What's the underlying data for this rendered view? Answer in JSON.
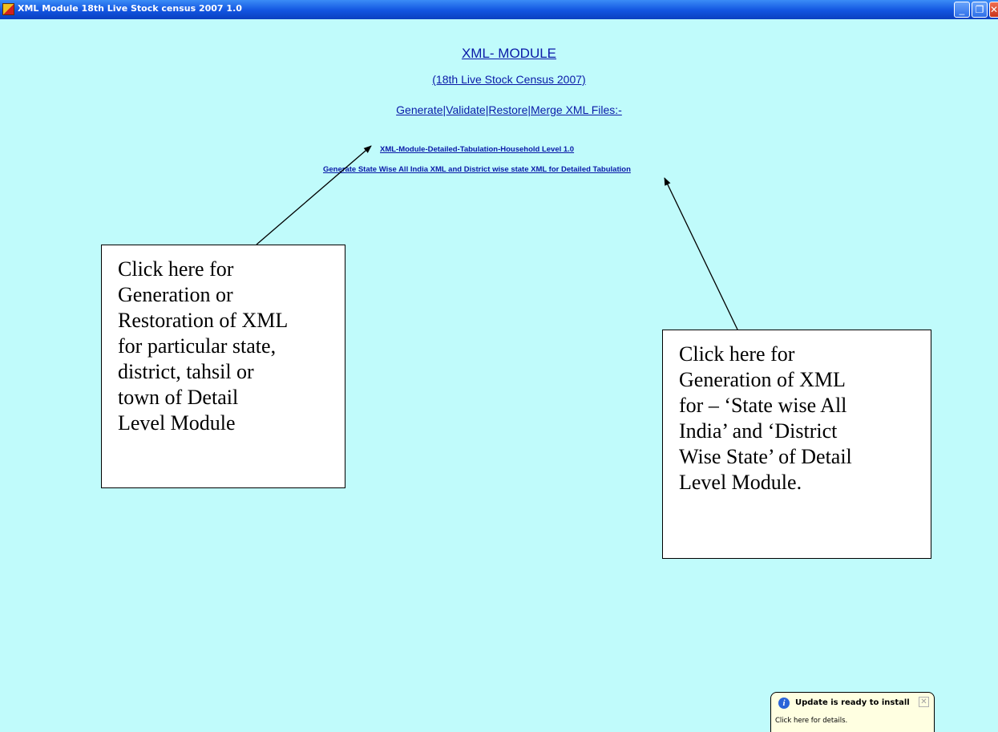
{
  "window": {
    "title": "XML Module 18th Live Stock census 2007 1.0",
    "controls": {
      "minimize": "_",
      "restore": "❐",
      "close": "✕"
    }
  },
  "main": {
    "heading": "XML- MODULE",
    "subheading": "(18th Live Stock Census 2007)",
    "actions": "Generate|Validate|Restore|Merge XML Files:-",
    "links": {
      "household": "XML-Module-Detailed-Tabulation-Household Level 1.0",
      "statewise": "Generate  State Wise All India XML and District wise state XML for Detailed Tabulation"
    }
  },
  "callouts": {
    "left": "Click here for\nGeneration or\nRestoration of XML\nfor particular state,\ndistrict, tahsil or\ntown of Detail\nLevel Module",
    "right": "Click here for\nGeneration of XML\nfor – ‘State wise All\nIndia’ and ‘District\nWise State’ of Detail\nLevel Module."
  },
  "notification": {
    "title": "Update is ready to install",
    "body": "Click here for details.",
    "close": "✕",
    "info_icon": "i"
  },
  "colors": {
    "background": "#c0fbfb",
    "titlebar": "#1254e0",
    "link": "#0a1aa8",
    "notification_bg": "#ffffe1"
  },
  "icons": [
    "app-icon",
    "info-icon",
    "close-icon"
  ]
}
